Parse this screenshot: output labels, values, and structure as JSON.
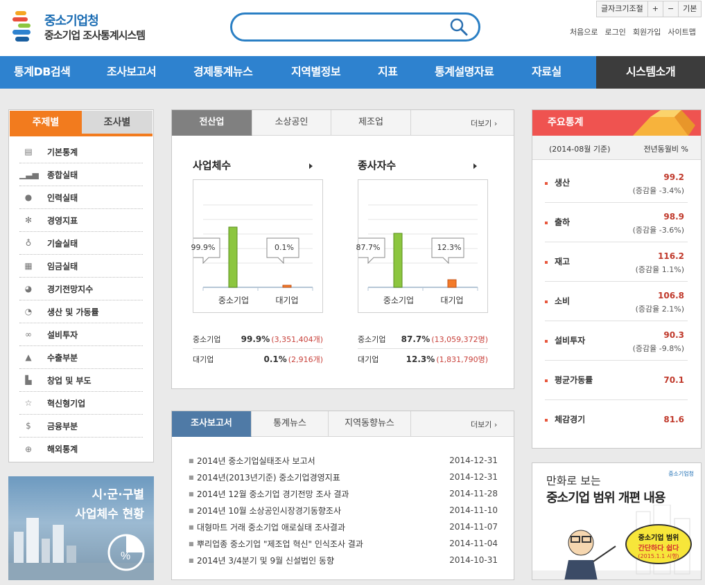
{
  "header": {
    "logo_line1": "중소기업청",
    "logo_line2": "중소기업 조사통계시스템",
    "search_placeholder": "",
    "font_size_label": "글자크기조절",
    "font_plus": "+",
    "font_minus": "−",
    "font_default": "기본",
    "util_links": [
      "처음으로",
      "로그인",
      "회원가입",
      "사이트맵"
    ]
  },
  "nav": {
    "items": [
      "통계DB검색",
      "조사보고서",
      "경제통계뉴스",
      "지역별정보",
      "지표",
      "통계설명자료",
      "자료실",
      "시스템소개"
    ]
  },
  "left": {
    "tabs": [
      "주제별",
      "조사별"
    ],
    "menu": [
      {
        "label": "기본통계",
        "icon": "document-icon"
      },
      {
        "label": "종합실태",
        "icon": "bar-chart-icon"
      },
      {
        "label": "인력실태",
        "icon": "person-icon"
      },
      {
        "label": "경영지표",
        "icon": "gear-icon"
      },
      {
        "label": "기술실태",
        "icon": "lightbulb-icon"
      },
      {
        "label": "임금실태",
        "icon": "calculator-icon"
      },
      {
        "label": "경기전망지수",
        "icon": "pie-icon"
      },
      {
        "label": "생산 및 가동률",
        "icon": "pie-chart-icon"
      },
      {
        "label": "설비투자",
        "icon": "link-icon"
      },
      {
        "label": "수출부분",
        "icon": "ship-icon"
      },
      {
        "label": "창업 및 부도",
        "icon": "building-icon"
      },
      {
        "label": "혁신형기업",
        "icon": "star-icon"
      },
      {
        "label": "금융부분",
        "icon": "dollar-icon"
      },
      {
        "label": "해외통계",
        "icon": "globe-icon"
      }
    ],
    "banner_line1": "시·군·구별",
    "banner_line2": "사업체수 현황"
  },
  "center_top": {
    "tabs": [
      "전산업",
      "소상공인",
      "제조업"
    ],
    "more": "더보기",
    "charts": [
      {
        "title": "사업체수",
        "small_label": "99.9%",
        "large_label": "0.1%",
        "cat_small": "중소기업",
        "cat_large": "대기업",
        "rows": [
          {
            "name": "중소기업",
            "pct": "99.9%",
            "count": "(3,351,404개)"
          },
          {
            "name": "대기업",
            "pct": "0.1%",
            "count": "(2,916개)"
          }
        ]
      },
      {
        "title": "종사자수",
        "small_label": "87.7%",
        "large_label": "12.3%",
        "cat_small": "중소기업",
        "cat_large": "대기업",
        "rows": [
          {
            "name": "중소기업",
            "pct": "87.7%",
            "count": "(13,059,372명)"
          },
          {
            "name": "대기업",
            "pct": "12.3%",
            "count": "(1,831,790명)"
          }
        ]
      }
    ]
  },
  "center_bottom": {
    "tabs": [
      "조사보고서",
      "통계뉴스",
      "지역동향뉴스"
    ],
    "more": "더보기",
    "news": [
      {
        "title": "2014년 중소기업실태조사 보고서",
        "date": "2014-12-31"
      },
      {
        "title": "2014년(2013년기준) 중소기업경영지표",
        "date": "2014-12-31"
      },
      {
        "title": "2014년 12월 중소기업 경기전망 조사 결과",
        "date": "2014-11-28"
      },
      {
        "title": "2014년 10월 소상공인시장경기동향조사",
        "date": "2014-11-10"
      },
      {
        "title": "대형마트 거래 중소기업 애로실태 조사결과",
        "date": "2014-11-07"
      },
      {
        "title": "뿌리업종 중소기업 \"제조업 혁신\" 인식조사 결과",
        "date": "2014-11-04"
      },
      {
        "title": "2014년 3/4분기 및 9월 신설법인 동향",
        "date": "2014-10-31"
      }
    ]
  },
  "right": {
    "title": "주요통계",
    "base_date": "(2014-08월 기준)",
    "compare": "전년동월비 %",
    "stats": [
      {
        "name": "생산",
        "value": "99.2",
        "change": "(증감율 -3.4%)"
      },
      {
        "name": "출하",
        "value": "98.9",
        "change": "(증감율 -3.6%)"
      },
      {
        "name": "재고",
        "value": "116.2",
        "change": "(증감율 1.1%)"
      },
      {
        "name": "소비",
        "value": "106.8",
        "change": "(증감율 2.1%)"
      },
      {
        "name": "설비투자",
        "value": "90.3",
        "change": "(증감율 -9.8%)"
      },
      {
        "name": "평균가동률",
        "value": "70.1",
        "change": ""
      },
      {
        "name": "체감경기",
        "value": "81.6",
        "change": ""
      }
    ],
    "banner_line1": "만화로 보는",
    "banner_line2": "중소기업 범위 개편 내용",
    "banner_brand": "중소기업청",
    "bubble1": "중소기업 범위",
    "bubble2": "간단하다 쉽다",
    "bubble3": "(2015.1.1 시행)"
  },
  "colors": {
    "nav_blue": "#2e82cf",
    "orange": "#f27b1e",
    "red_head": "#ef5350",
    "bar_green": "#8cc63f",
    "bar_orange": "#f37b2a"
  }
}
